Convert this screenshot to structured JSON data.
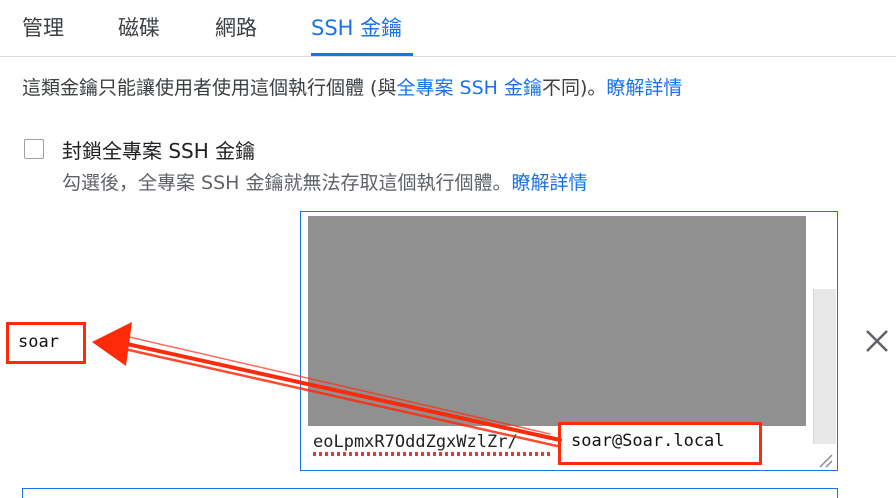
{
  "tabs": [
    {
      "label": "管理"
    },
    {
      "label": "磁碟"
    },
    {
      "label": "網路"
    },
    {
      "label": "SSH 金鑰"
    }
  ],
  "active_tab": "SSH 金鑰",
  "description": {
    "prefix": "這類金鑰只能讓使用者使用這個執行個體 (與",
    "link": "全專案 SSH 金鑰",
    "suffix": "不同)。",
    "learn_more": "瞭解詳情"
  },
  "block_project_keys": {
    "title": "封鎖全專案 SSH 金鑰",
    "checked": false,
    "subtext": "勾選後，全專案 SSH 金鑰就無法存取這個執行個體。",
    "learn_more": "瞭解詳情"
  },
  "ssh_key": {
    "visible_fragment": "eoLpmxR7OddZgxWzlZr/",
    "comment": "soar@Soar.local",
    "redacted": true
  },
  "annotation": {
    "username": "soar",
    "color": "#ff2a0a"
  },
  "icons": {
    "remove": "close-icon",
    "resize": "resize-grip-icon"
  },
  "colors": {
    "accent": "#1a73e8",
    "annotation": "#ff2a0a",
    "redaction": "#909090"
  }
}
